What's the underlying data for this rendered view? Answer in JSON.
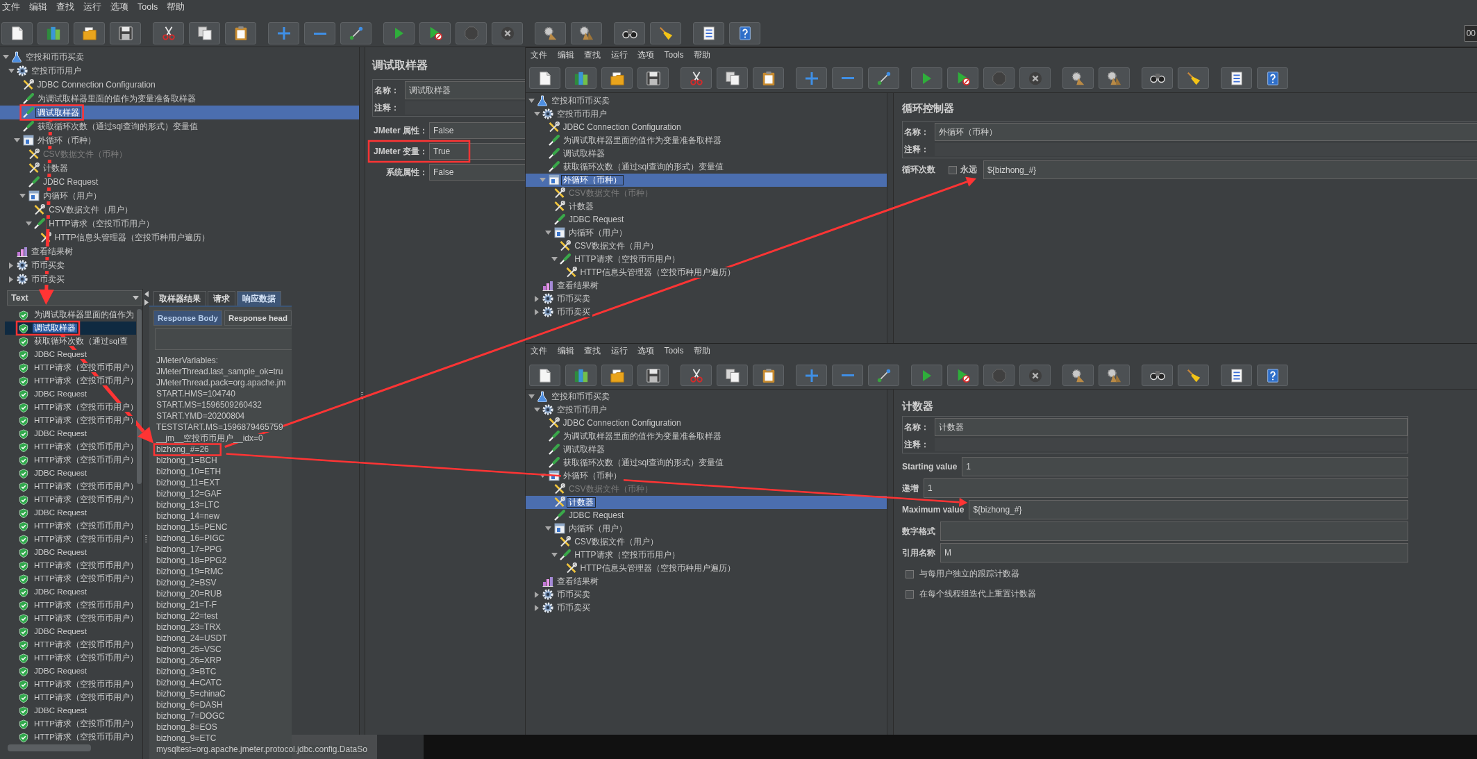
{
  "main_window": {
    "menu": [
      "文件",
      "编辑",
      "查找",
      "运行",
      "选项",
      "Tools",
      "帮助"
    ],
    "toolbar": [
      [
        {
          "kind": "new",
          "disabled": false
        },
        {
          "kind": "templates",
          "disabled": false
        },
        {
          "kind": "open",
          "disabled": false
        },
        {
          "kind": "save",
          "disabled": false
        }
      ],
      [
        {
          "kind": "cut",
          "disabled": false
        },
        {
          "kind": "copy",
          "disabled": false
        },
        {
          "kind": "paste",
          "disabled": false
        }
      ],
      [
        {
          "kind": "expand",
          "disabled": false
        },
        {
          "kind": "collapse",
          "disabled": false
        },
        {
          "kind": "toggle",
          "disabled": false
        }
      ],
      [
        {
          "kind": "start",
          "disabled": false
        },
        {
          "kind": "start_no_pauses",
          "disabled": false
        },
        {
          "kind": "stop",
          "disabled": true
        },
        {
          "kind": "shutdown",
          "disabled": true
        }
      ],
      [
        {
          "kind": "clear",
          "disabled": false
        },
        {
          "kind": "clear_all",
          "disabled": false
        }
      ],
      [
        {
          "kind": "search",
          "disabled": false
        },
        {
          "kind": "reset_search",
          "disabled": false
        }
      ],
      [
        {
          "kind": "function_helper",
          "disabled": false
        },
        {
          "kind": "help",
          "disabled": false
        }
      ]
    ],
    "timer": "00",
    "tree": [
      {
        "kind": "test_plan",
        "label": "空投和币币买卖",
        "selected": false,
        "disabled": false,
        "expanded": true,
        "children": [
          {
            "kind": "thread_group",
            "label": "空投币币用户",
            "selected": false,
            "disabled": false,
            "expanded": true,
            "children": [
              {
                "kind": "config",
                "label": "JDBC Connection Configuration",
                "selected": false,
                "disabled": false
              },
              {
                "kind": "sampler",
                "label": "为调试取样器里面的值作为变量准备取样器",
                "selected": false,
                "disabled": false
              },
              {
                "kind": "sampler",
                "label": "调试取样器",
                "selected": true,
                "disabled": false
              },
              {
                "kind": "sampler",
                "label": "获取循环次数（通过sql查询的形式）变量值",
                "selected": false,
                "disabled": false
              },
              {
                "kind": "controller",
                "label": "外循环（币种）",
                "selected": false,
                "disabled": false,
                "expanded": true,
                "children": [
                  {
                    "kind": "config",
                    "label": "CSV数据文件（币种）",
                    "selected": false,
                    "disabled": true
                  },
                  {
                    "kind": "config",
                    "label": "计数器",
                    "selected": false,
                    "disabled": false
                  },
                  {
                    "kind": "sampler",
                    "label": "JDBC Request",
                    "selected": false,
                    "disabled": false
                  },
                  {
                    "kind": "controller",
                    "label": "内循环（用户）",
                    "selected": false,
                    "disabled": false,
                    "expanded": true,
                    "children": [
                      {
                        "kind": "config",
                        "label": "CSV数据文件（用户）",
                        "selected": false,
                        "disabled": false
                      },
                      {
                        "kind": "sampler",
                        "label": "HTTP请求（空投币币用户）",
                        "selected": false,
                        "disabled": false,
                        "expanded": true,
                        "children": [
                          {
                            "kind": "config",
                            "label": "HTTP信息头管理器（空投币种用户遍历）",
                            "selected": false,
                            "disabled": false
                          }
                        ]
                      }
                    ]
                  }
                ]
              }
            ]
          },
          {
            "kind": "listener",
            "label": "查看结果树",
            "selected": false,
            "disabled": false
          },
          {
            "kind": "thread_group",
            "label": "币币买卖",
            "selected": false,
            "disabled": false,
            "expanded": false
          },
          {
            "kind": "thread_group",
            "label": "币币卖买",
            "selected": false,
            "disabled": false,
            "expanded": false
          }
        ]
      }
    ],
    "panel": {
      "kind": "debug_sampler",
      "title": "调试取样器",
      "name_box": [
        {
          "label": "名称：",
          "value": "调试取样器"
        },
        {
          "label": "注释："
        }
      ],
      "fields": [
        {
          "label": "JMeter 属性：",
          "value": "False"
        },
        {
          "label": "JMeter 变量：",
          "value": "True"
        },
        {
          "label": "系统属性：",
          "value": "False"
        }
      ]
    }
  },
  "results_window": {
    "renderer": "Text",
    "results": [
      {
        "label": "为调试取样器里面的值作为",
        "selected": false
      },
      {
        "label": "调试取样器",
        "selected": true
      },
      {
        "label": "获取循环次数（通过sql查",
        "selected": false
      },
      {
        "label": "JDBC Request",
        "selected": false
      },
      {
        "label": "HTTP请求（空投币币用户）",
        "selected": false
      },
      {
        "label": "HTTP请求（空投币币用户）",
        "selected": false
      },
      {
        "label": "JDBC Request",
        "selected": false
      },
      {
        "label": "HTTP请求（空投币币用户）",
        "selected": false
      },
      {
        "label": "HTTP请求（空投币币用户）",
        "selected": false
      },
      {
        "label": "JDBC Request",
        "selected": false
      },
      {
        "label": "HTTP请求（空投币币用户）",
        "selected": false
      },
      {
        "label": "HTTP请求（空投币币用户）",
        "selected": false
      },
      {
        "label": "JDBC Request",
        "selected": false
      },
      {
        "label": "HTTP请求（空投币币用户）",
        "selected": false
      },
      {
        "label": "HTTP请求（空投币币用户）",
        "selected": false
      },
      {
        "label": "JDBC Request",
        "selected": false
      },
      {
        "label": "HTTP请求（空投币币用户）",
        "selected": false
      },
      {
        "label": "HTTP请求（空投币币用户）",
        "selected": false
      },
      {
        "label": "JDBC Request",
        "selected": false
      },
      {
        "label": "HTTP请求（空投币币用户）",
        "selected": false
      },
      {
        "label": "HTTP请求（空投币币用户）",
        "selected": false
      },
      {
        "label": "JDBC Request",
        "selected": false
      },
      {
        "label": "HTTP请求（空投币币用户）",
        "selected": false
      },
      {
        "label": "HTTP请求（空投币币用户）",
        "selected": false
      },
      {
        "label": "JDBC Request",
        "selected": false
      },
      {
        "label": "HTTP请求（空投币币用户）",
        "selected": false
      },
      {
        "label": "HTTP请求（空投币币用户）",
        "selected": false
      },
      {
        "label": "JDBC Request",
        "selected": false
      },
      {
        "label": "HTTP请求（空投币币用户）",
        "selected": false
      },
      {
        "label": "HTTP请求（空投币币用户）",
        "selected": false
      },
      {
        "label": "JDBC Request",
        "selected": false
      },
      {
        "label": "HTTP请求（空投币币用户）",
        "selected": false
      },
      {
        "label": "HTTP请求（空投币币用户）",
        "selected": false
      }
    ],
    "tabs": [
      {
        "label": "取样器结果",
        "selected": false
      },
      {
        "label": "请求",
        "selected": false
      },
      {
        "label": "响应数据",
        "selected": true
      }
    ],
    "subtabs": [
      {
        "label": "Response Body",
        "selected": true
      },
      {
        "label": "Response head",
        "selected": false
      }
    ],
    "response_lines": [
      "JMeterVariables:",
      "JMeterThread.last_sample_ok=tru",
      "JMeterThread.pack=org.apache.jm",
      "START.HMS=104740",
      "START.MS=1596509260432",
      "START.YMD=20200804",
      "TESTSTART.MS=1596879465759",
      "__jm__空投币币用户__idx=0",
      "bizhong_#=26",
      "bizhong_1=BCH",
      "bizhong_10=ETH",
      "bizhong_11=EXT",
      "bizhong_12=GAF",
      "bizhong_13=LTC",
      "bizhong_14=new",
      "bizhong_15=PENC",
      "bizhong_16=PIGC",
      "bizhong_17=PPG",
      "bizhong_18=PPG2",
      "bizhong_19=RMC",
      "bizhong_2=BSV",
      "bizhong_20=RUB",
      "bizhong_21=T-F",
      "bizhong_22=test",
      "bizhong_23=TRX",
      "bizhong_24=USDT",
      "bizhong_25=VSC",
      "bizhong_26=XRP",
      "bizhong_3=BTC",
      "bizhong_4=CATC",
      "bizhong_5=chinaC",
      "bizhong_6=DASH",
      "bizhong_7=DOGC",
      "bizhong_8=EOS",
      "bizhong_9=ETC",
      "mysqltest=org.apache.jmeter.protocol.jdbc.config.DataSo"
    ]
  },
  "loop_window": {
    "menu": [
      "文件",
      "编辑",
      "查找",
      "运行",
      "选项",
      "Tools",
      "帮助"
    ],
    "toolbar": [
      [
        {
          "kind": "new",
          "disabled": false
        },
        {
          "kind": "templates",
          "disabled": false
        },
        {
          "kind": "open",
          "disabled": false
        },
        {
          "kind": "save",
          "disabled": false
        }
      ],
      [
        {
          "kind": "cut",
          "disabled": false
        },
        {
          "kind": "copy",
          "disabled": false
        },
        {
          "kind": "paste",
          "disabled": false
        }
      ],
      [
        {
          "kind": "expand",
          "disabled": false
        },
        {
          "kind": "collapse",
          "disabled": false
        },
        {
          "kind": "toggle",
          "disabled": false
        }
      ],
      [
        {
          "kind": "start",
          "disabled": false
        },
        {
          "kind": "start_no_pauses",
          "disabled": false
        },
        {
          "kind": "stop",
          "disabled": true
        },
        {
          "kind": "shutdown",
          "disabled": true
        }
      ],
      [
        {
          "kind": "clear",
          "disabled": false
        },
        {
          "kind": "clear_all",
          "disabled": false
        }
      ],
      [
        {
          "kind": "search",
          "disabled": false
        },
        {
          "kind": "reset_search",
          "disabled": false
        }
      ],
      [
        {
          "kind": "function_helper",
          "disabled": false
        },
        {
          "kind": "help",
          "disabled": false
        }
      ]
    ],
    "tree": [
      {
        "kind": "test_plan",
        "label": "空投和币币买卖",
        "selected": false,
        "disabled": false,
        "expanded": true,
        "children": [
          {
            "kind": "thread_group",
            "label": "空投币币用户",
            "selected": false,
            "disabled": false,
            "expanded": true,
            "children": [
              {
                "kind": "config",
                "label": "JDBC Connection Configuration",
                "selected": false,
                "disabled": false
              },
              {
                "kind": "sampler",
                "label": "为调试取样器里面的值作为变量准备取样器",
                "selected": false,
                "disabled": false
              },
              {
                "kind": "sampler",
                "label": "调试取样器",
                "selected": false,
                "disabled": false
              },
              {
                "kind": "sampler",
                "label": "获取循环次数（通过sql查询的形式）变量值",
                "selected": false,
                "disabled": false
              },
              {
                "kind": "controller",
                "label": "外循环（币种）",
                "selected": true,
                "disabled": false,
                "expanded": true,
                "children": [
                  {
                    "kind": "config",
                    "label": "CSV数据文件（币种）",
                    "selected": false,
                    "disabled": true
                  },
                  {
                    "kind": "config",
                    "label": "计数器",
                    "selected": false,
                    "disabled": false
                  },
                  {
                    "kind": "sampler",
                    "label": "JDBC Request",
                    "selected": false,
                    "disabled": false
                  },
                  {
                    "kind": "controller",
                    "label": "内循环（用户）",
                    "selected": false,
                    "disabled": false,
                    "expanded": true,
                    "children": [
                      {
                        "kind": "config",
                        "label": "CSV数据文件（用户）",
                        "selected": false,
                        "disabled": false
                      },
                      {
                        "kind": "sampler",
                        "label": "HTTP请求（空投币币用户）",
                        "selected": false,
                        "disabled": false,
                        "expanded": true,
                        "children": [
                          {
                            "kind": "config",
                            "label": "HTTP信息头管理器（空投币种用户遍历）",
                            "selected": false,
                            "disabled": false
                          }
                        ]
                      }
                    ]
                  }
                ]
              }
            ]
          },
          {
            "kind": "listener",
            "label": "查看结果树",
            "selected": false,
            "disabled": false
          },
          {
            "kind": "thread_group",
            "label": "币币买卖",
            "selected": false,
            "disabled": false,
            "expanded": false
          },
          {
            "kind": "thread_group",
            "label": "币币卖买",
            "selected": false,
            "disabled": false,
            "expanded": false
          }
        ]
      }
    ],
    "panel": {
      "kind": "loop_controller",
      "title": "循环控制器",
      "name_box": [
        {
          "label": "名称：",
          "value": "外循环（币种）"
        },
        {
          "label": "注释："
        }
      ],
      "loop": {
        "label": "循环次数",
        "forever": {
          "label": "永远",
          "checked": false
        },
        "value": "${bizhong_#}"
      }
    }
  },
  "counter_window": {
    "menu": [
      "文件",
      "编辑",
      "查找",
      "运行",
      "选项",
      "Tools",
      "帮助"
    ],
    "toolbar": [
      [
        {
          "kind": "new",
          "disabled": false
        },
        {
          "kind": "templates",
          "disabled": false
        },
        {
          "kind": "open",
          "disabled": false
        },
        {
          "kind": "save",
          "disabled": false
        }
      ],
      [
        {
          "kind": "cut",
          "disabled": false
        },
        {
          "kind": "copy",
          "disabled": false
        },
        {
          "kind": "paste",
          "disabled": false
        }
      ],
      [
        {
          "kind": "expand",
          "disabled": false
        },
        {
          "kind": "collapse",
          "disabled": false
        },
        {
          "kind": "toggle",
          "disabled": false
        }
      ],
      [
        {
          "kind": "start",
          "disabled": false
        },
        {
          "kind": "start_no_pauses",
          "disabled": false
        },
        {
          "kind": "stop",
          "disabled": true
        },
        {
          "kind": "shutdown",
          "disabled": true
        }
      ],
      [
        {
          "kind": "clear",
          "disabled": false
        },
        {
          "kind": "clear_all",
          "disabled": false
        }
      ],
      [
        {
          "kind": "search",
          "disabled": false
        },
        {
          "kind": "reset_search",
          "disabled": false
        }
      ],
      [
        {
          "kind": "function_helper",
          "disabled": false
        },
        {
          "kind": "help",
          "disabled": false
        }
      ]
    ],
    "tree": [
      {
        "kind": "test_plan",
        "label": "空投和币币买卖",
        "selected": false,
        "disabled": false,
        "expanded": true,
        "children": [
          {
            "kind": "thread_group",
            "label": "空投币币用户",
            "selected": false,
            "disabled": false,
            "expanded": true,
            "children": [
              {
                "kind": "config",
                "label": "JDBC Connection Configuration",
                "selected": false,
                "disabled": false
              },
              {
                "kind": "sampler",
                "label": "为调试取样器里面的值作为变量准备取样器",
                "selected": false,
                "disabled": false
              },
              {
                "kind": "sampler",
                "label": "调试取样器",
                "selected": false,
                "disabled": false
              },
              {
                "kind": "sampler",
                "label": "获取循环次数（通过sql查询的形式）变量值",
                "selected": false,
                "disabled": false
              },
              {
                "kind": "controller",
                "label": "外循环（币种）",
                "selected": false,
                "disabled": false,
                "expanded": true,
                "children": [
                  {
                    "kind": "config",
                    "label": "CSV数据文件（币种）",
                    "selected": false,
                    "disabled": true
                  },
                  {
                    "kind": "config",
                    "label": "计数器",
                    "selected": true,
                    "disabled": false
                  },
                  {
                    "kind": "sampler",
                    "label": "JDBC Request",
                    "selected": false,
                    "disabled": false
                  },
                  {
                    "kind": "controller",
                    "label": "内循环（用户）",
                    "selected": false,
                    "disabled": false,
                    "expanded": true,
                    "children": [
                      {
                        "kind": "config",
                        "label": "CSV数据文件（用户）",
                        "selected": false,
                        "disabled": false
                      },
                      {
                        "kind": "sampler",
                        "label": "HTTP请求（空投币币用户）",
                        "selected": false,
                        "disabled": false,
                        "expanded": true,
                        "children": [
                          {
                            "kind": "config",
                            "label": "HTTP信息头管理器（空投币种用户遍历）",
                            "selected": false,
                            "disabled": false
                          }
                        ]
                      }
                    ]
                  }
                ]
              }
            ]
          },
          {
            "kind": "listener",
            "label": "查看结果树",
            "selected": false,
            "disabled": false
          },
          {
            "kind": "thread_group",
            "label": "币币买卖",
            "selected": false,
            "disabled": false,
            "expanded": false
          },
          {
            "kind": "thread_group",
            "label": "币币卖买",
            "selected": false,
            "disabled": false,
            "expanded": false
          }
        ]
      }
    ],
    "panel": {
      "kind": "counter",
      "title": "计数器",
      "name_box": [
        {
          "label": "名称：",
          "value": "计数器"
        },
        {
          "label": "注释："
        }
      ],
      "fields": [
        {
          "label": "Starting value",
          "value": "1"
        },
        {
          "label": "递增",
          "value": "1"
        },
        {
          "label": "Maximum value",
          "value": "${bizhong_#}"
        },
        {
          "label": "数字格式"
        },
        {
          "label": "引用名称",
          "value": "M"
        }
      ],
      "options": [
        {
          "label": "与每用户独立的跟踪计数器",
          "checked": false
        },
        {
          "label": "在每个线程组迭代上重置计数器",
          "checked": false
        }
      ]
    }
  },
  "annotations": [
    {
      "kind": "box"
    },
    {
      "kind": "box"
    },
    {
      "kind": "box"
    },
    {
      "kind": "box"
    },
    {
      "kind": "arrow"
    },
    {
      "kind": "arrow"
    },
    {
      "kind": "arrow"
    },
    {
      "kind": "arrow"
    }
  ]
}
